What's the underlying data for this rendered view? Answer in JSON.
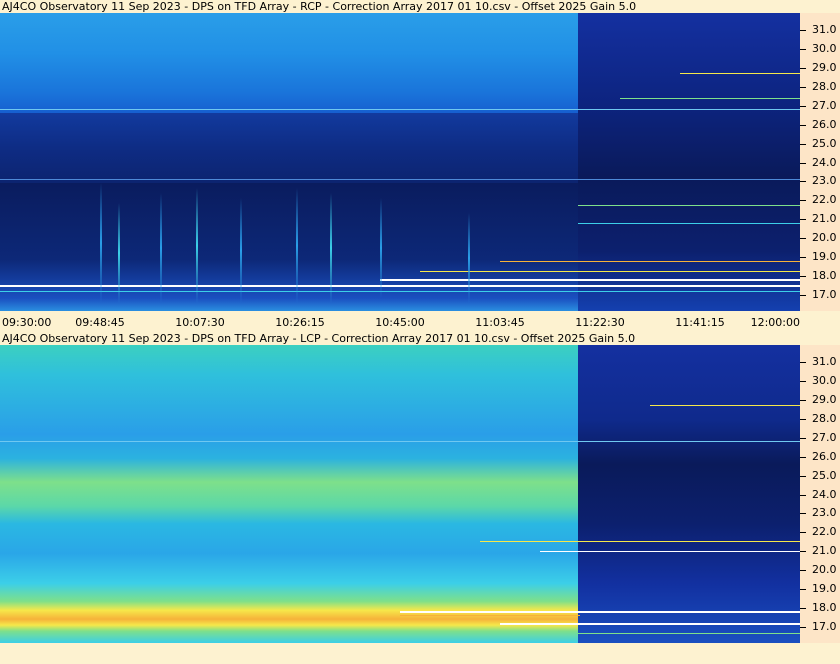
{
  "panels": [
    {
      "title": "AJ4CO Observatory 11 Sep 2023  -  DPS on TFD Array  -  RCP  -  Correction Array 2017 01 10.csv  -  Offset 2025  Gain 5.0",
      "polarization": "RCP"
    },
    {
      "title": "AJ4CO Observatory 11 Sep 2023  -  DPS on TFD Array  -  LCP  -  Correction Array 2017 01 10.csv  -  Offset 2025  Gain 5.0",
      "polarization": "LCP"
    }
  ],
  "freq_labels": [
    "31.0",
    "30.0",
    "29.0",
    "28.0",
    "27.0",
    "26.0",
    "25.0",
    "24.0",
    "23.0",
    "22.0",
    "21.0",
    "20.0",
    "19.0",
    "18.0",
    "17.0"
  ],
  "time_labels": [
    "09:30:00",
    "09:48:45",
    "10:07:30",
    "10:26:15",
    "10:45:00",
    "11:03:45",
    "11:22:30",
    "11:41:15",
    "12:00:00"
  ],
  "colors": {
    "background": "#fdf2d0",
    "axis_background": "#fde5c7",
    "dark_navy": "#0b1a5a",
    "deep_blue": "#16329c",
    "mid_blue": "#1f6fe0",
    "sky_blue": "#2a9ee8",
    "cyan": "#3ccfe8",
    "green": "#7ee08a",
    "yellow": "#f6e84a",
    "orange": "#f6b23a",
    "white": "#ffffff"
  }
}
